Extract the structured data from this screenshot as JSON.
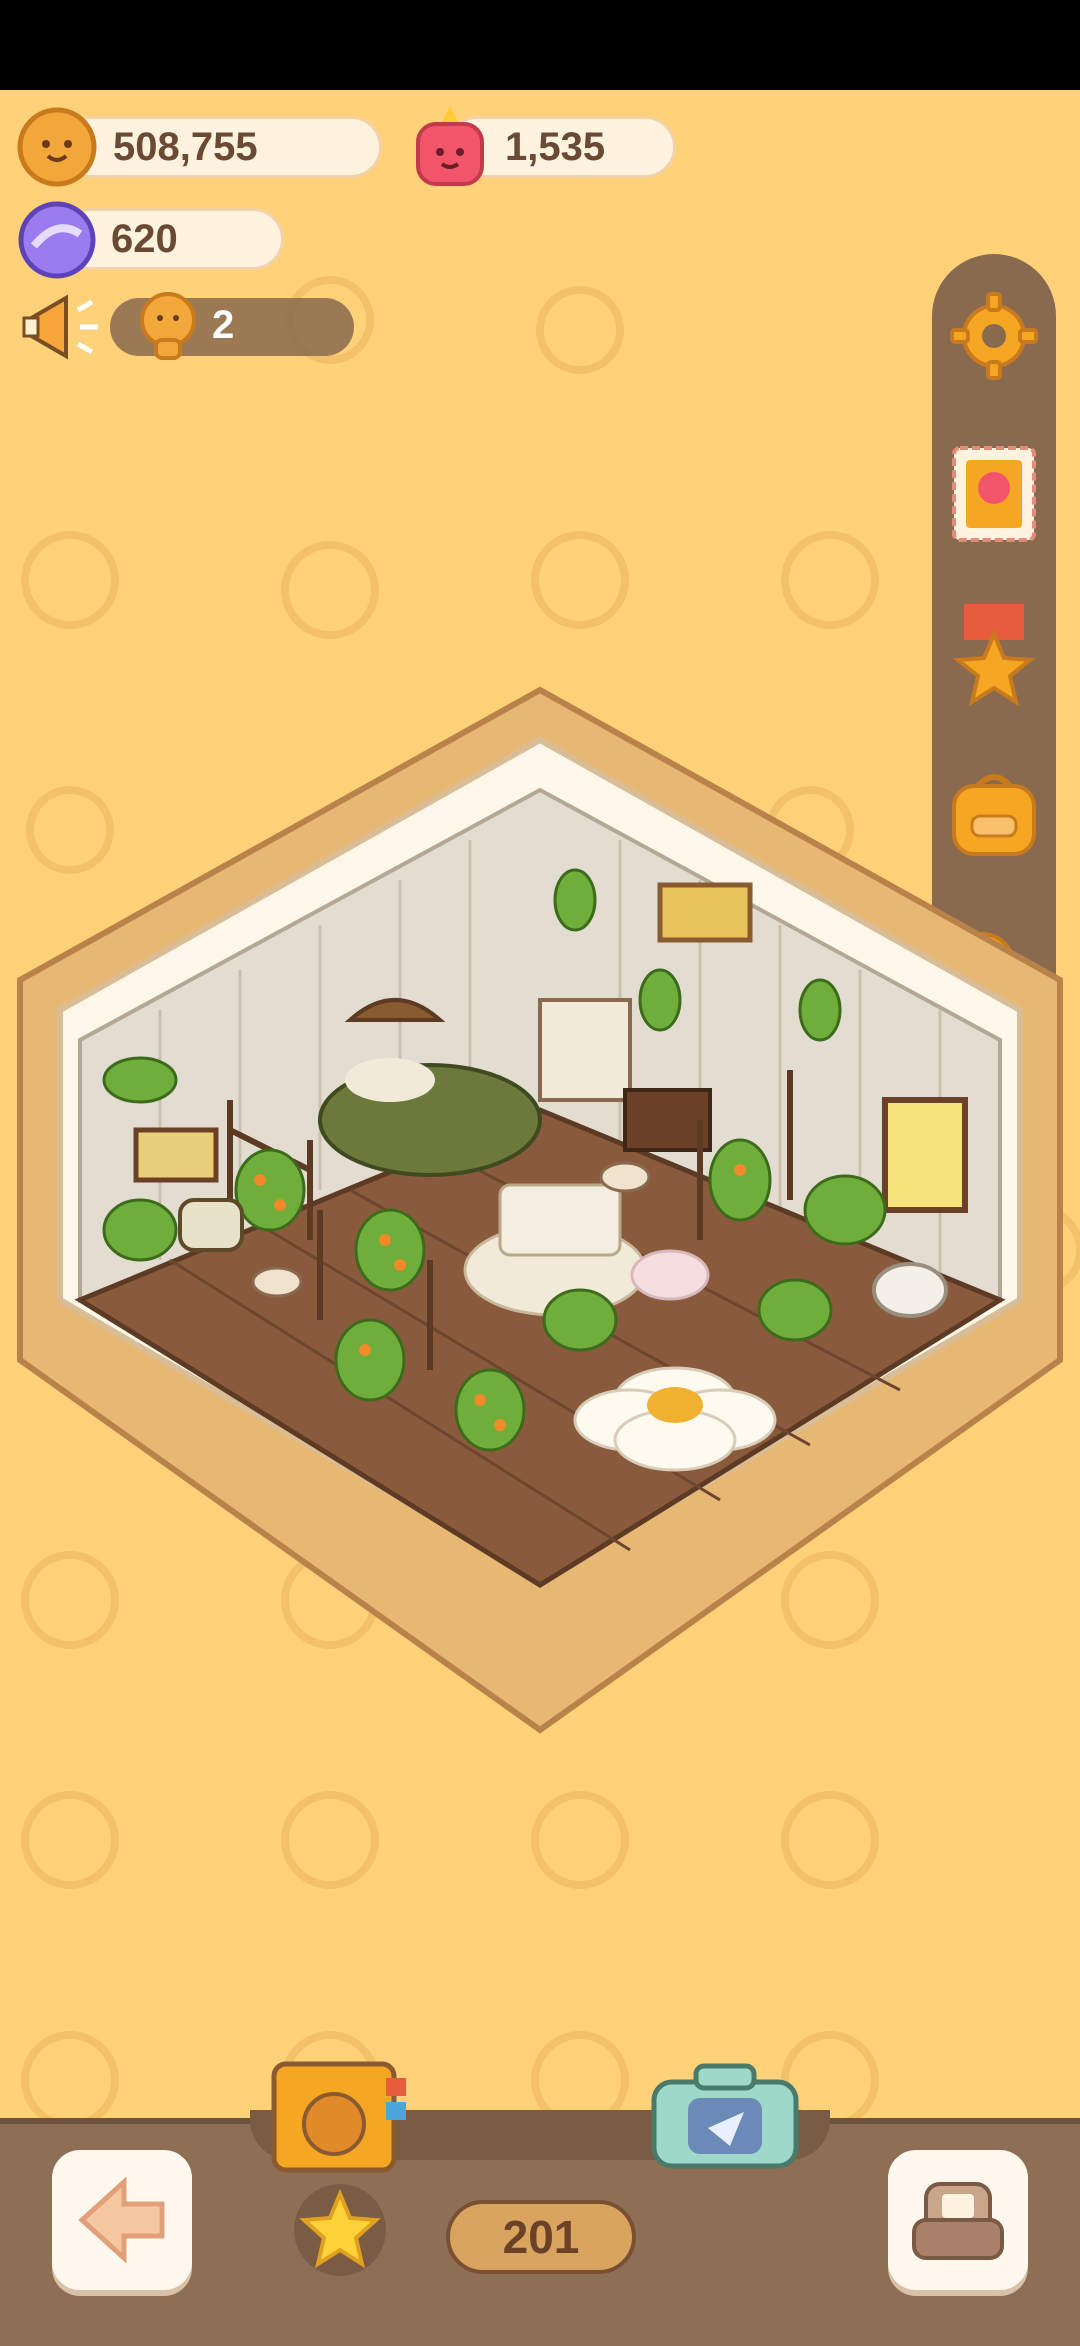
{
  "currencies": {
    "cookies": {
      "icon": "cookie-coin-icon",
      "value": "508,755"
    },
    "gems": {
      "icon": "red-gem-icon",
      "value": "1,535"
    },
    "candy": {
      "icon": "purple-candy-icon",
      "value": "620"
    }
  },
  "notice": {
    "icon": "megaphone-icon",
    "friend_icon": "cookie-friend-icon",
    "count": "2"
  },
  "side_rail": [
    {
      "icon": "gear-icon"
    },
    {
      "icon": "stamp-icon"
    },
    {
      "icon": "medal-icon"
    },
    {
      "icon": "backpack-icon"
    },
    {
      "icon": "friends-icon"
    }
  ],
  "bottom_bar": {
    "back_icon": "back-arrow-icon",
    "star_icon": "star-icon",
    "counter": "201",
    "furniture_icon": "sofa-icon",
    "folder_icon": "cookie-book-icon",
    "camera_icon": "camera-icon"
  },
  "colors": {
    "background": "#ffd27a",
    "bar": "#8e6f55",
    "accent": "#f5a623"
  }
}
